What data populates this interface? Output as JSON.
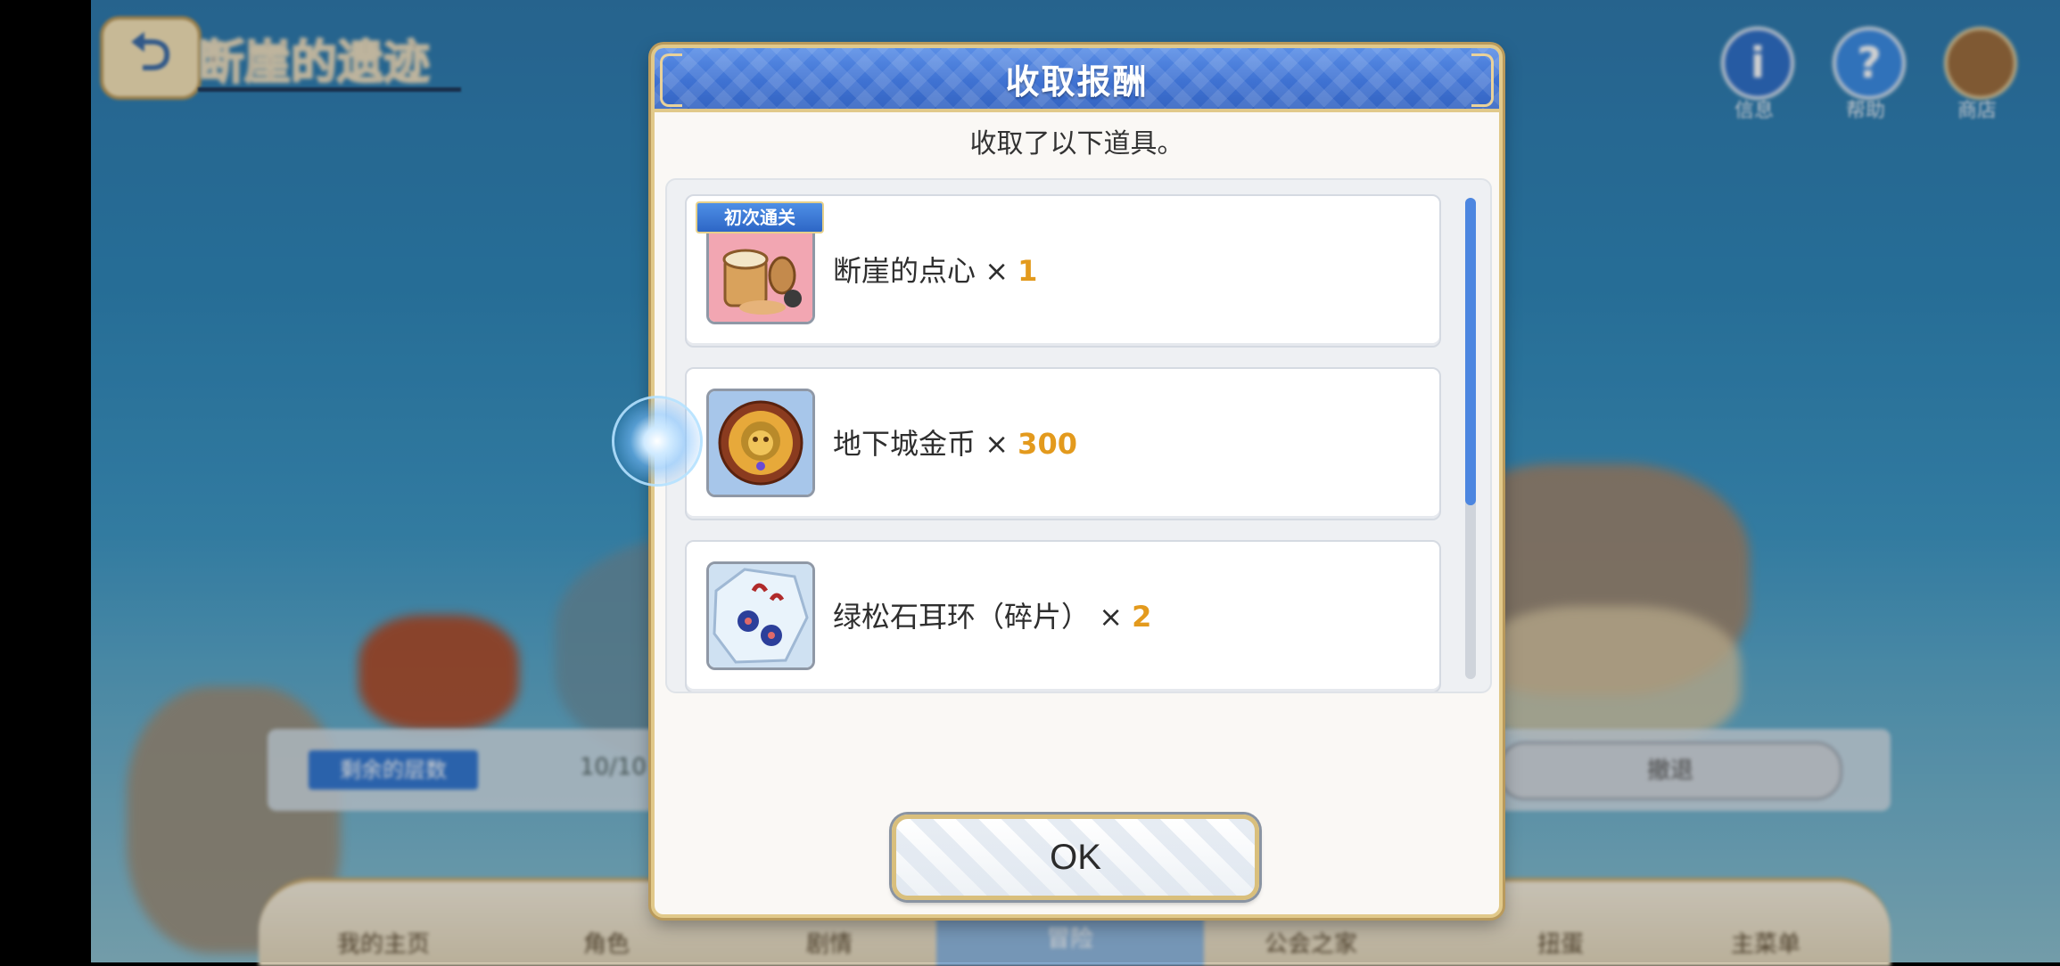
{
  "background": {
    "stage_title": "断崖的遗迹",
    "top_icons": [
      {
        "icon": "info-icon",
        "label": "信息"
      },
      {
        "icon": "help-icon",
        "label": "帮助"
      },
      {
        "icon": "shop-icon",
        "label": "商店"
      }
    ],
    "info_bar": {
      "tag": "剩余的层数",
      "count": "10/10",
      "retreat_label": "撤退"
    },
    "bottom_nav": [
      "我的主页",
      "角色",
      "剧情",
      "冒险",
      "公会之家",
      "扭蛋",
      "主菜单"
    ]
  },
  "dialog": {
    "title": "收取报酬",
    "subtitle": "收取了以下道具。",
    "items": [
      {
        "name": "断崖的点心",
        "times": "×",
        "qty": "1",
        "badge": "初次通关",
        "icon": "snack-icon"
      },
      {
        "name": "地下城金币",
        "times": "×",
        "qty": "300",
        "badge": "",
        "icon": "dungeon-coin-icon"
      },
      {
        "name": "绿松石耳环（碎片）",
        "times": "×",
        "qty": "2",
        "badge": "",
        "icon": "turquoise-earring-fragment-icon"
      }
    ],
    "ok_label": "OK"
  },
  "colors": {
    "header_blue": "#3f72d2",
    "gold_border": "#e1c98a",
    "quantity_orange": "#e39a1d",
    "scroll_thumb": "#4c86e0"
  }
}
